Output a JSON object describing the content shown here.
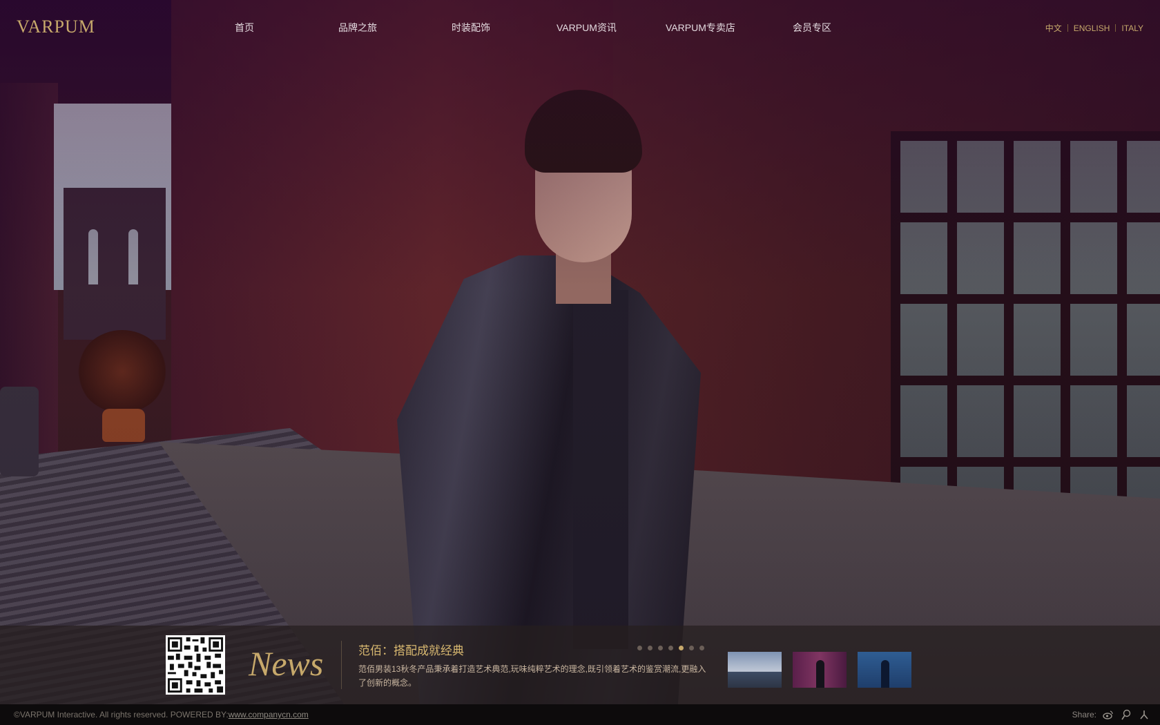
{
  "brand": {
    "logo_text": "VARPUM"
  },
  "nav": {
    "items": [
      {
        "label": "首页"
      },
      {
        "label": "品牌之旅"
      },
      {
        "label": "时装配饰"
      },
      {
        "label": "VARPUM资讯"
      },
      {
        "label": "VARPUM专卖店"
      },
      {
        "label": "会员专区"
      }
    ]
  },
  "languages": [
    {
      "label": "中文"
    },
    {
      "label": "ENGLISH"
    },
    {
      "label": "ITALY"
    }
  ],
  "news": {
    "heading": "News",
    "title": "范佰：搭配成就经典",
    "description": "范佰男装13秋冬产品秉承着打造艺术典范,玩味纯粹艺术的理念,既引领着艺术的鉴赏潮流,更融入了创新的概念。",
    "slide_count": 7,
    "active_slide": 5,
    "thumbnails": [
      {
        "name": "bridge-scene",
        "color": "#7f93b3"
      },
      {
        "name": "street-model",
        "color": "#803562"
      },
      {
        "name": "blue-model",
        "color": "#2f5d93"
      }
    ]
  },
  "footer": {
    "copyright": "©VARPUM Interactive. All rights reserved. POWERED BY:",
    "powered_link": "www.companycn.com",
    "share_label": "Share:",
    "share_icons": [
      "weibo-icon",
      "tencent-weibo-icon",
      "renren-icon"
    ]
  },
  "colors": {
    "accent": "#c7a96b",
    "nav_text": "#e4dbe0",
    "news_title": "#d8b870"
  }
}
